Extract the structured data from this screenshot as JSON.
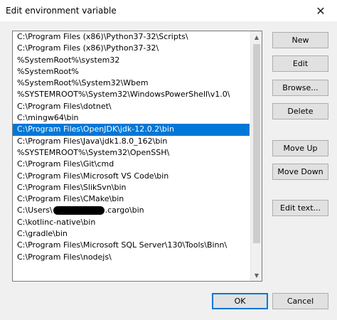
{
  "window": {
    "title": "Edit environment variable",
    "close_glyph": "✕"
  },
  "list": {
    "items": [
      {
        "text": "C:\\Program Files (x86)\\Python37-32\\Scripts\\"
      },
      {
        "text": "C:\\Program Files (x86)\\Python37-32\\"
      },
      {
        "text": "%SystemRoot%\\system32"
      },
      {
        "text": "%SystemRoot%"
      },
      {
        "text": "%SystemRoot%\\System32\\Wbem"
      },
      {
        "text": "%SYSTEMROOT%\\System32\\WindowsPowerShell\\v1.0\\"
      },
      {
        "text": "C:\\Program Files\\dotnet\\"
      },
      {
        "text": "C:\\mingw64\\bin"
      },
      {
        "text": "C:\\Program Files\\OpenJDK\\jdk-12.0.2\\bin",
        "selected": true
      },
      {
        "text": "C:\\Program Files\\Java\\jdk1.8.0_162\\bin"
      },
      {
        "text": "%SYSTEMROOT%\\System32\\OpenSSH\\"
      },
      {
        "text": "C:\\Program Files\\Git\\cmd"
      },
      {
        "text": "C:\\Program Files\\Microsoft VS Code\\bin"
      },
      {
        "text": "C:\\Program Files\\SlikSvn\\bin"
      },
      {
        "text": "C:\\Program Files\\CMake\\bin"
      },
      {
        "text": "C:\\Users\\",
        "redacted": true,
        "suffix": ".cargo\\bin"
      },
      {
        "text": "C:\\kotlinc-native\\bin"
      },
      {
        "text": "C:\\gradle\\bin"
      },
      {
        "text": "C:\\Program Files\\Microsoft SQL Server\\130\\Tools\\Binn\\"
      },
      {
        "text": "C:\\Program Files\\nodejs\\"
      }
    ]
  },
  "buttons": {
    "new": "New",
    "edit": "Edit",
    "browse": "Browse...",
    "delete": "Delete",
    "move_up": "Move Up",
    "move_down": "Move Down",
    "edit_text": "Edit text...",
    "ok": "OK",
    "cancel": "Cancel"
  },
  "colors": {
    "selection": "#0078d7",
    "default_button_border": "#0078d7"
  }
}
